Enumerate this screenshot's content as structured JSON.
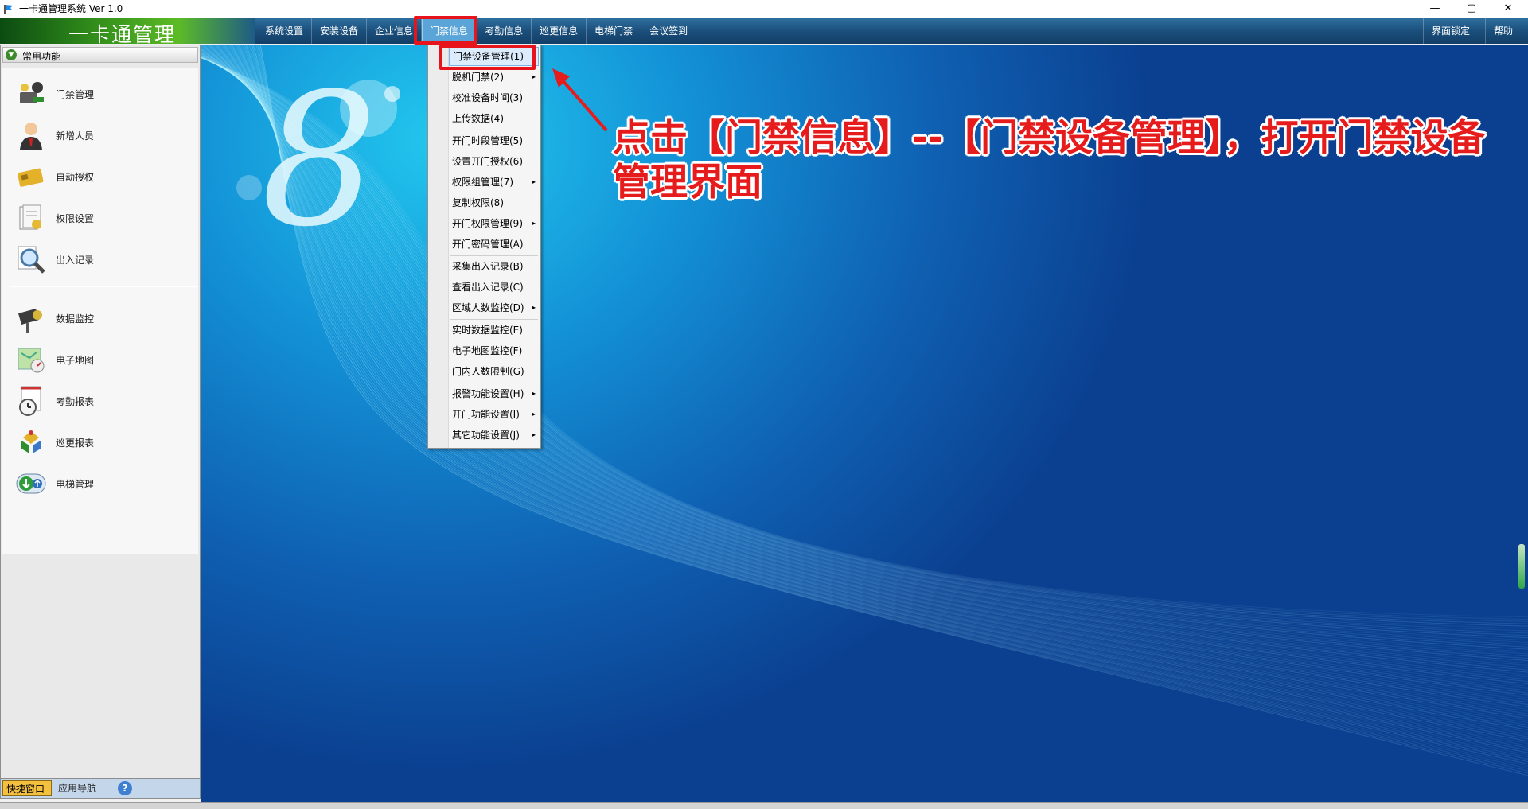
{
  "window": {
    "title": "一卡通管理系统 Ver 1.0",
    "min": "—",
    "max": "▢",
    "close": "✕"
  },
  "banner": {
    "logo_text": "一卡通管理"
  },
  "menu": {
    "items": [
      "系统设置",
      "安装设备",
      "企业信息",
      "门禁信息",
      "考勤信息",
      "巡更信息",
      "电梯门禁",
      "会议签到"
    ],
    "lock": "界面锁定",
    "help": "帮助"
  },
  "dropdown": {
    "items": [
      {
        "label": "门禁设备管理(1)"
      },
      {
        "label": "脱机门禁(2)",
        "submenu": "▸"
      },
      {
        "label": "校准设备时间(3)"
      },
      {
        "label": "上传数据(4)"
      },
      {
        "label": "开门时段管理(5)"
      },
      {
        "label": "设置开门授权(6)"
      },
      {
        "label": "权限组管理(7)",
        "submenu": "▸"
      },
      {
        "label": "复制权限(8)"
      },
      {
        "label": "开门权限管理(9)",
        "submenu": "▸"
      },
      {
        "label": "开门密码管理(A)"
      },
      {
        "label": "采集出入记录(B)"
      },
      {
        "label": "查看出入记录(C)"
      },
      {
        "label": "区域人数监控(D)",
        "submenu": "▸"
      },
      {
        "label": "实时数据监控(E)"
      },
      {
        "label": "电子地图监控(F)"
      },
      {
        "label": "门内人数限制(G)"
      },
      {
        "label": "报警功能设置(H)",
        "submenu": "▸"
      },
      {
        "label": "开门功能设置(I)",
        "submenu": "▸"
      },
      {
        "label": "其它功能设置(J)",
        "submenu": "▸"
      }
    ]
  },
  "left_panel": {
    "header": "常用功能",
    "toggle_icon": "▼",
    "items": [
      {
        "label": "门禁管理",
        "icon": "access-control-icon"
      },
      {
        "label": "新增人员",
        "icon": "person-icon"
      },
      {
        "label": "自动授权",
        "icon": "card-icon"
      },
      {
        "label": "权限设置",
        "icon": "document-icon"
      },
      {
        "label": "出入记录",
        "icon": "magnifier-icon"
      },
      {
        "label": "数据监控",
        "icon": "camera-icon"
      },
      {
        "label": "电子地图",
        "icon": "map-icon"
      },
      {
        "label": "考勤报表",
        "icon": "clock-icon"
      },
      {
        "label": "巡更报表",
        "icon": "patrol-icon"
      },
      {
        "label": "电梯管理",
        "icon": "elevator-icon"
      }
    ],
    "tabs": {
      "quick": "快捷窗口",
      "nav": "应用导航",
      "help": "?"
    }
  },
  "annotation": {
    "text": "点击【门禁信息】--【门禁设备管理】，打开门禁设备管理界面"
  },
  "colors": {
    "annotation_red": "#e61b1b",
    "menu_highlight": "#5aa4d8"
  }
}
